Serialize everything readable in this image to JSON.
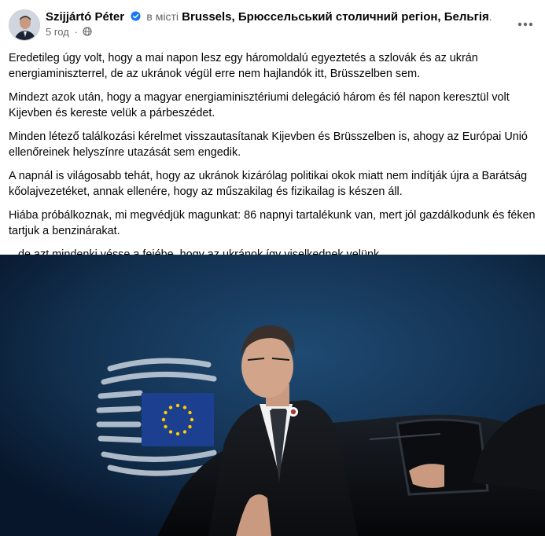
{
  "post": {
    "author": "Szijjártó Péter",
    "location_prefix": "в місті",
    "location": "Brussels, Брюссельський столичний регіон, Бельгія",
    "location_suffix": ".",
    "time": "5 год",
    "separator": "·",
    "icons": {
      "verified": "verified-badge-icon",
      "audience": "globe-icon",
      "more": "more-options-icon"
    },
    "paragraphs": [
      "Eredetileg úgy volt, hogy a mai napon lesz egy háromoldalú egyeztetés a szlovák és az ukrán energiaminiszterrel, de az ukránok végül erre nem hajlandók itt, Brüsszelben sem.",
      "Mindezt azok után, hogy a magyar energiaminisztériumi delegáció három és fél napon keresztül volt Kijevben és kereste velük a párbeszédet.",
      "Minden létező találkozási kérelmet visszautasítanak Kijevben és Brüsszelben is, ahogy az Európai Unió ellenőreinek helyszínre utazását sem engedik.",
      "A napnál is világosabb tehát, hogy az ukránok kizárólag politikai okok miatt nem indítják újra a Barátság kőolajvezetéket, annak ellenére, hogy az műszakilag és fizikailag is készen áll.",
      "Hiába próbálkoznak, mi megvédjük magunkat: 86 napnyi tartalékunk van, mert jól gazdálkodunk és féken tartjuk a benzinárakat.",
      "...de azt mindenki vésse a fejébe, hogy az ukránok így viselkednek velünk."
    ]
  },
  "colors": {
    "verified": "#1877f2",
    "secondary_text": "#65676b",
    "photo_background": "#0d1f37",
    "eu_flag": "#1c3f8f",
    "eu_stars": "#ffcc00"
  }
}
